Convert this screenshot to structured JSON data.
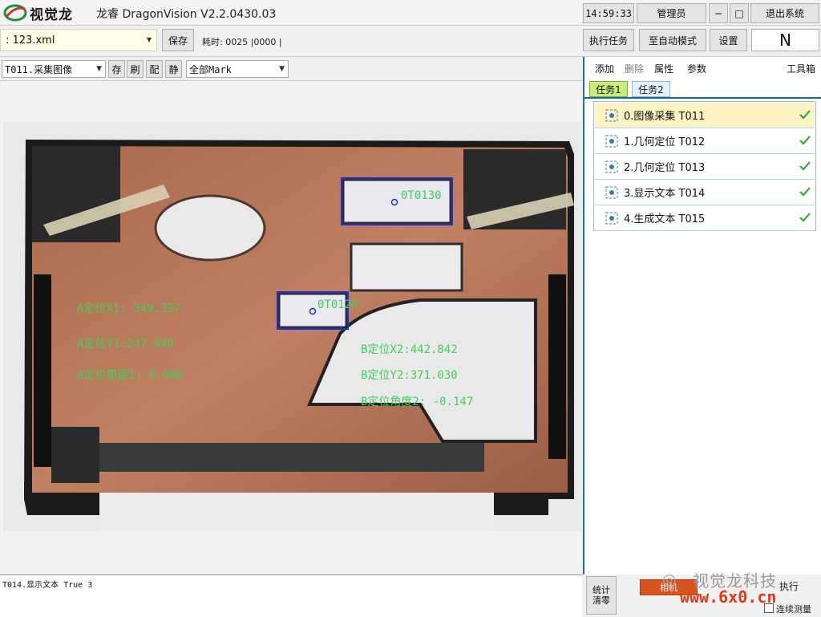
{
  "titlebar": {
    "logo_text": "视觉龙",
    "app_title": "龙睿 DragonVision V2.2.0430.03",
    "clock": "14:59:33",
    "user": "管理员",
    "minimize": "−",
    "maximize": "□",
    "exit": "退出系统"
  },
  "toolbar": {
    "file": ": 123.xml",
    "save": "保存",
    "time_label": "耗时: 0025  |0000  |",
    "run_task": "执行任务",
    "auto_mode": "至自动模式",
    "settings": "设置",
    "mode_indicator": "N"
  },
  "image_toolbar": {
    "tool_select": "T011.采集图像",
    "btn_store": "存",
    "btn_refresh": "刷",
    "btn_config": "配",
    "btn_static": "静",
    "mark_select": "全部Mark"
  },
  "overlays": {
    "region_a": "0T0120",
    "region_b": "0T0130",
    "a_x": "A定位X1: 349.337",
    "a_y": "A定位Y1:247.440",
    "a_angle": "A定位角度1: 0.000",
    "b_x": "B定位X2:442.842",
    "b_y": "B定位Y2:371.030",
    "b_angle": "B定位角度2: -0.147"
  },
  "right_panel": {
    "add": "添加",
    "delete": "删除",
    "properties": "属性",
    "params": "参数",
    "toolbox": "工具箱",
    "tabs": [
      "任务1",
      "任务2"
    ],
    "tasks": [
      {
        "label": "0.图像采集 T011",
        "selected": true
      },
      {
        "label": "1.几何定位 T012",
        "selected": false
      },
      {
        "label": "2.几何定位 T013",
        "selected": false
      },
      {
        "label": "3.显示文本 T014",
        "selected": false
      },
      {
        "label": "4.生成文本 T015",
        "selected": false
      }
    ]
  },
  "bottom": {
    "log": "T014.显示文本  True 3",
    "stats_line1": "统计",
    "stats_line2": "清零",
    "camera": "相机",
    "watermark_text": "视觉龙科技",
    "watermark_url": "www.6x0.cn",
    "exec": "执行",
    "continuous": "连续测量"
  },
  "colors": {
    "overlay_text": "#3fd05a",
    "region_outline": "#1c2fd6",
    "selected_task_bg": "#fcf3c2",
    "check": "#34a93c",
    "tab_active": "#c9eb7a",
    "camera_button": "#d9531e"
  }
}
